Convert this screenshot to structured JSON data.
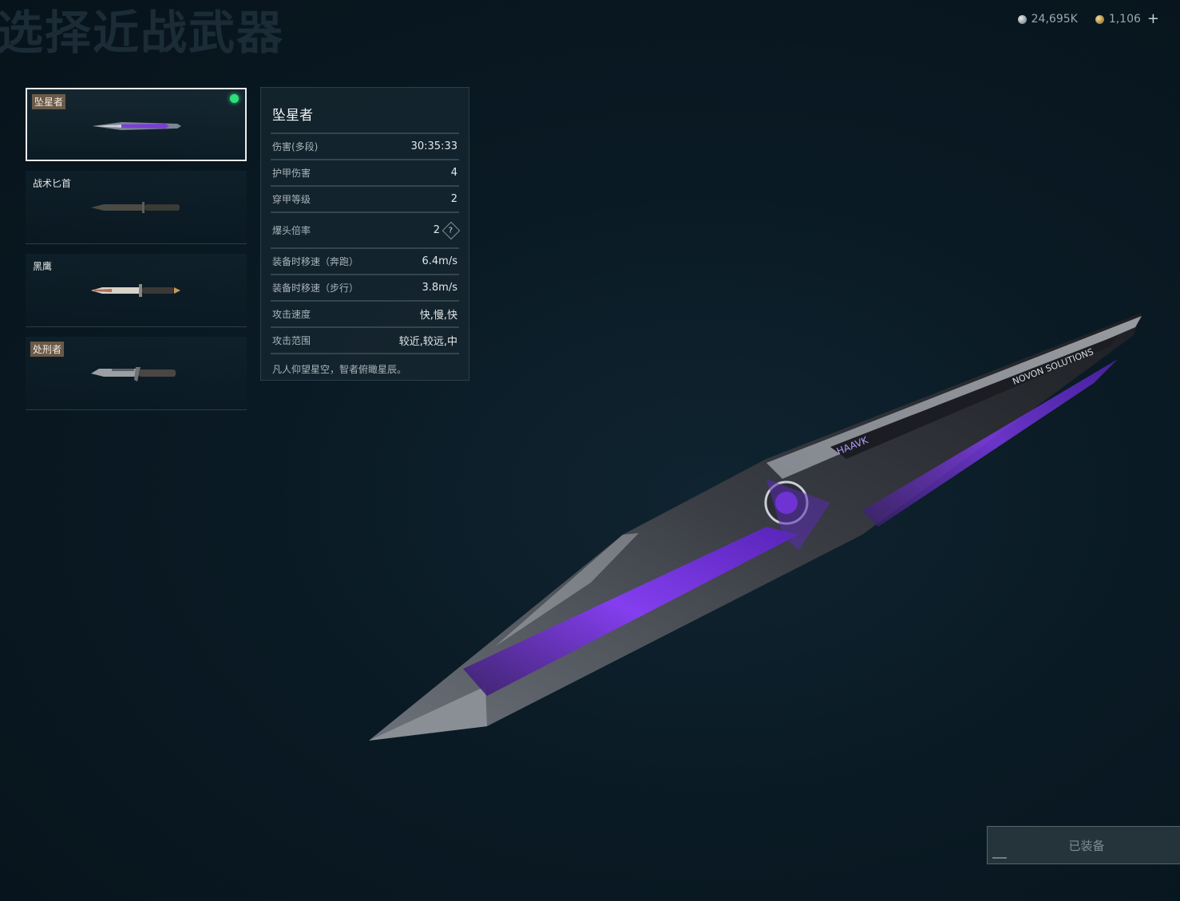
{
  "page": {
    "title": "选择近战武器"
  },
  "currency": [
    {
      "icon": "silver-coin-icon",
      "value": "24,695K"
    },
    {
      "icon": "gold-coin-icon",
      "value": "1,106"
    }
  ],
  "weapons": [
    {
      "name": "坠星者",
      "selected": true,
      "equipped": true,
      "tagged": true
    },
    {
      "name": "战术匕首",
      "selected": false,
      "equipped": false,
      "tagged": false
    },
    {
      "name": "黑鹰",
      "selected": false,
      "equipped": false,
      "tagged": false
    },
    {
      "name": "处刑者",
      "selected": false,
      "equipped": false,
      "tagged": true
    }
  ],
  "stats": {
    "title": "坠星者",
    "rows": [
      {
        "label": "伤害(多段)",
        "value": "30:35:33"
      },
      {
        "label": "护甲伤害",
        "value": "4"
      },
      {
        "label": "穿甲等级",
        "value": "2"
      },
      {
        "label": "爆头倍率",
        "value": "2",
        "help": "?"
      },
      {
        "label": "装备时移速（奔跑）",
        "value": "6.4m/s"
      },
      {
        "label": "装备时移速（步行）",
        "value": "3.8m/s"
      },
      {
        "label": "攻击速度",
        "value": "快,慢,快"
      },
      {
        "label": "攻击范围",
        "value": "较近,较远,中"
      }
    ],
    "flavor": "凡人仰望星空，智者俯瞰星辰。"
  },
  "hero": {
    "brand_text": "HAAVK",
    "side_text": "NOVON SOLUTIONS"
  },
  "equip_button": {
    "label": "已装备"
  },
  "colors": {
    "accent_purple": "#8a3cff",
    "equipped_green": "#2ee07a",
    "tag_bg": "#6a5a48"
  }
}
